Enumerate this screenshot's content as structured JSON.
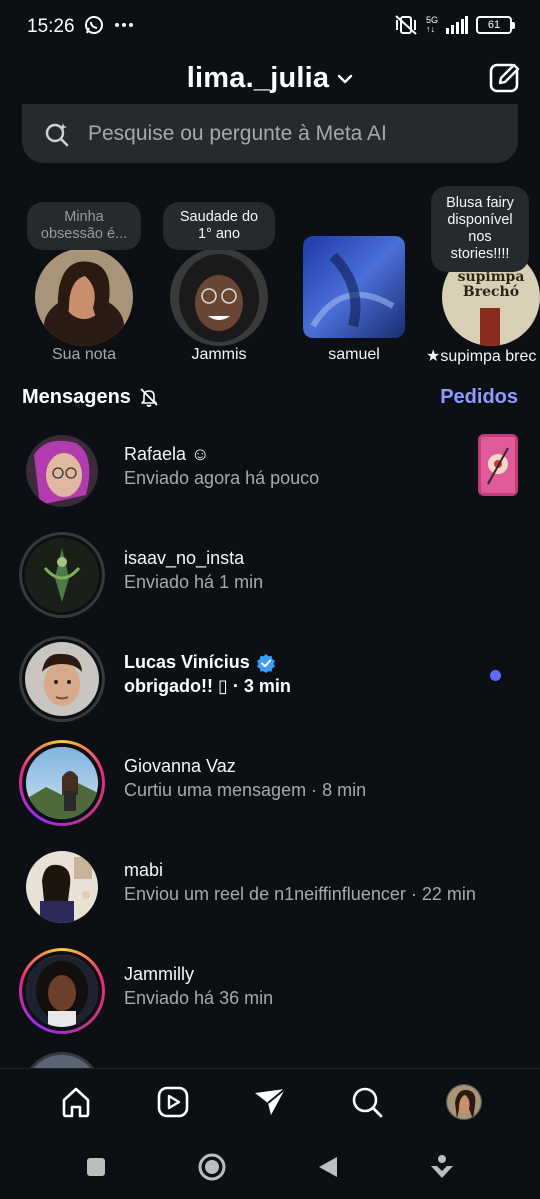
{
  "status_bar": {
    "time": "15:26",
    "network": "5G",
    "battery": "61"
  },
  "header": {
    "account_name": "lima._julia"
  },
  "search": {
    "placeholder": "Pesquise ou pergunte à Meta AI"
  },
  "notes": [
    {
      "bubble": "Minha obsessão é...",
      "name": "Sua nota",
      "muted": true
    },
    {
      "bubble": "Saudade do 1° ano",
      "name": "Jammis"
    },
    {
      "bubble": "",
      "name": "samuel"
    },
    {
      "bubble": "Blusa fairy disponível nos stories!!!!",
      "name": "★supimpa brec",
      "avatar_text": "supimpa Brechó"
    }
  ],
  "messages": {
    "title": "Mensagens",
    "requests_label": "Pedidos"
  },
  "threads": [
    {
      "name": "Rafaela ☺",
      "subtitle": "Enviado agora há pouco",
      "unread": false
    },
    {
      "name": "isaav_no_insta",
      "subtitle": "Enviado há 1 min",
      "unread": false
    },
    {
      "name": "Lucas Vinícius",
      "subtitle": "obrigado!! ▯ · 3 min",
      "unread": true,
      "verified": true
    },
    {
      "name": "Giovanna Vaz",
      "subtitle": "Curtiu uma mensagem · 8 min",
      "unread": false
    },
    {
      "name": "mabi",
      "subtitle": "Enviou um reel de n1neiffinfluencer · 22 min",
      "unread": false
    },
    {
      "name": "Jammilly",
      "subtitle": "Enviado há 36 min",
      "unread": false
    }
  ],
  "colors": {
    "background": "#0c1014",
    "accent": "#8e9bff",
    "unread_dot": "#5b6bff",
    "verified": "#3b9cff"
  },
  "icons": {
    "compose": "compose-icon",
    "search_ai": "meta-ai-search-icon",
    "mute": "bell-off-icon",
    "nav": [
      "home-icon",
      "reels-icon",
      "direct-icon",
      "search-icon",
      "profile-avatar"
    ]
  }
}
